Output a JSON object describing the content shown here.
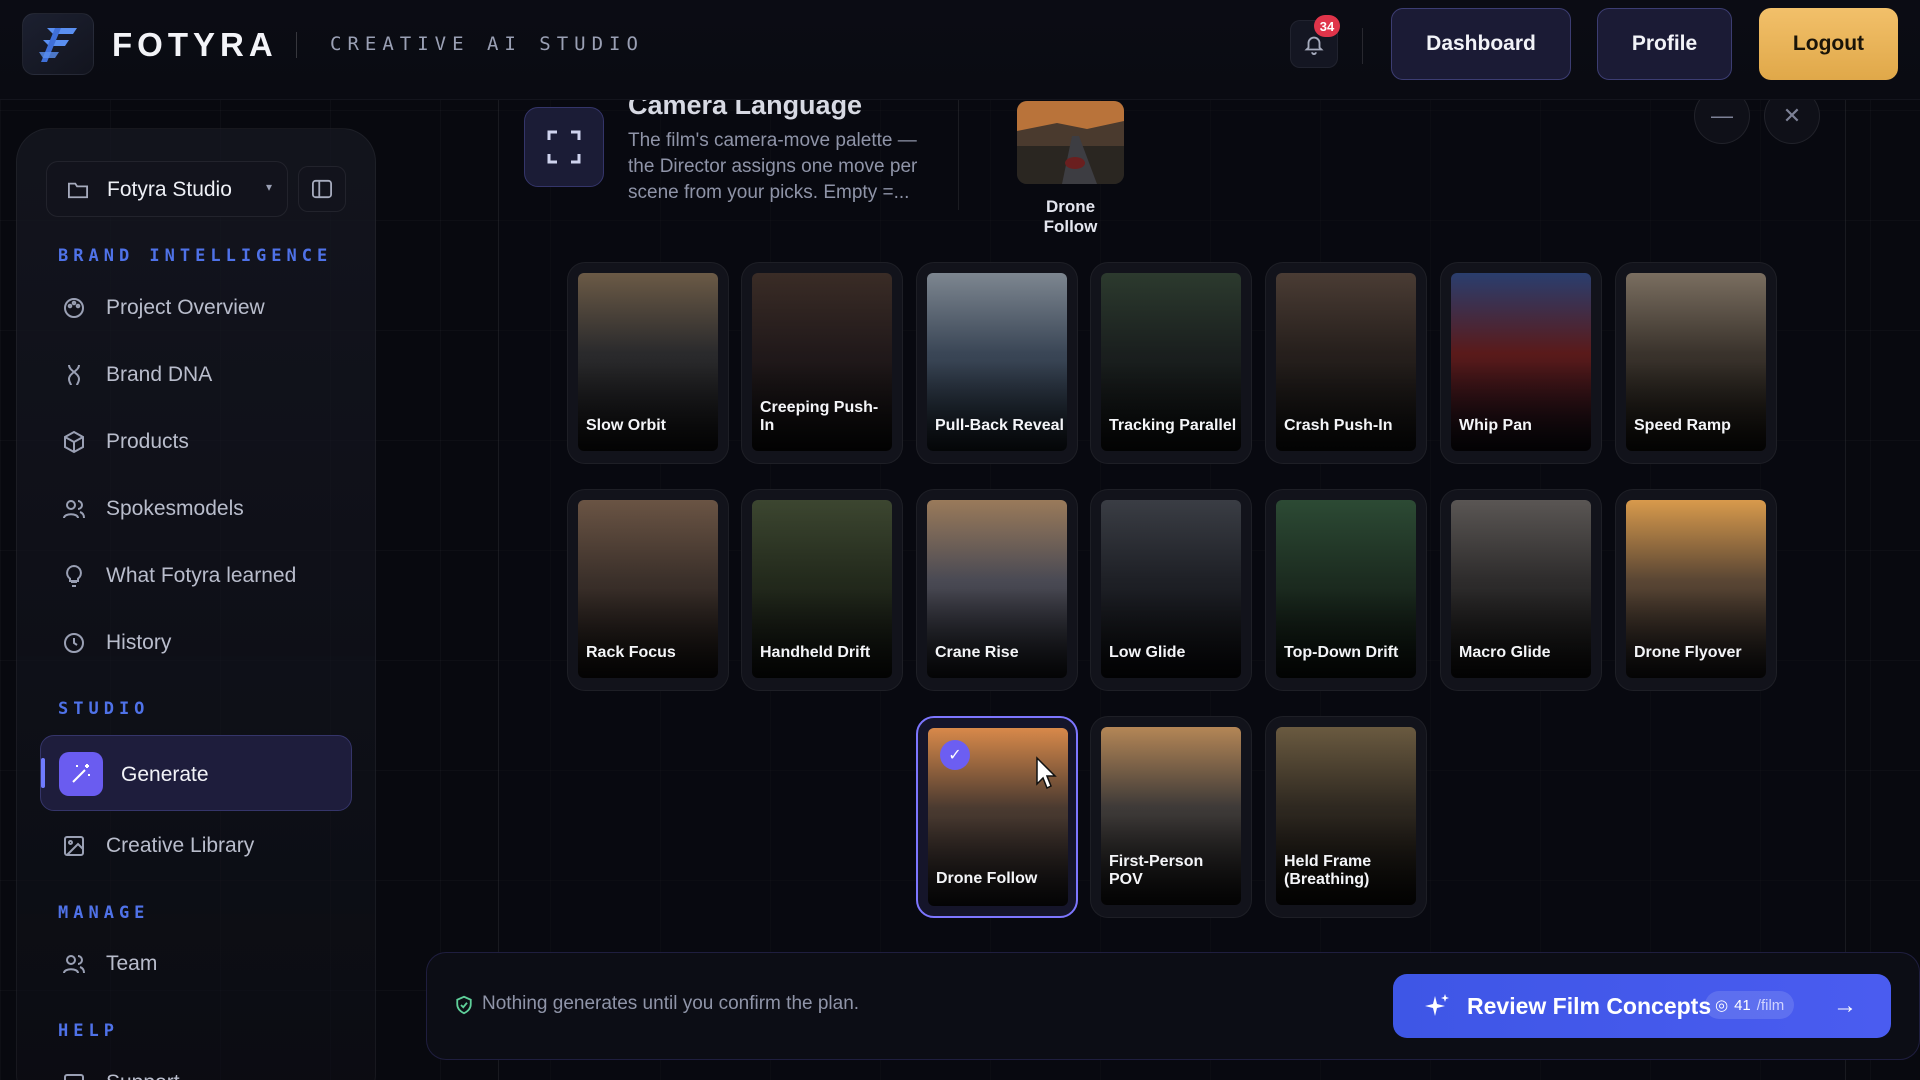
{
  "header": {
    "brand": "FOTYRA",
    "tagline": "CREATIVE AI STUDIO",
    "notification_count": "34",
    "dashboard_label": "Dashboard",
    "profile_label": "Profile",
    "logout_label": "Logout"
  },
  "sidebar": {
    "workspace": "Fotyra Studio",
    "sections": {
      "brand_intelligence": "BRAND INTELLIGENCE",
      "studio": "STUDIO",
      "manage": "MANAGE",
      "help": "HELP"
    },
    "items": {
      "project_overview": "Project Overview",
      "brand_dna": "Brand DNA",
      "products": "Products",
      "spokesmodels": "Spokesmodels",
      "what_learned": "What Fotyra learned",
      "history": "History",
      "generate": "Generate",
      "creative_library": "Creative Library",
      "team": "Team",
      "support": "Support"
    }
  },
  "panel": {
    "title": "Camera Language",
    "description": "The film's camera-move palette — the Director assigns one move per scene from your picks. Empty =...",
    "selected_label": "Drone Follow"
  },
  "moves": [
    "Slow Orbit",
    "Creeping Push-In",
    "Pull-Back Reveal",
    "Tracking Parallel",
    "Crash Push-In",
    "Whip Pan",
    "Speed Ramp",
    "Rack Focus",
    "Handheld Drift",
    "Crane Rise",
    "Low Glide",
    "Top-Down Drift",
    "Macro Glide",
    "Drone Flyover",
    "Drone Follow",
    "First-Person POV",
    "Held Frame (Breathing)"
  ],
  "footer": {
    "note": "Nothing generates until you confirm the plan.",
    "cta_label": "Review Film Concepts",
    "cost_value": "41",
    "cost_unit": "/film"
  },
  "colors": {
    "accent": "#4f72e8",
    "primary_button": "#3e56e6",
    "logout": "#e0a849",
    "selected_border": "#7d76ff",
    "badge": "#e0344a"
  }
}
